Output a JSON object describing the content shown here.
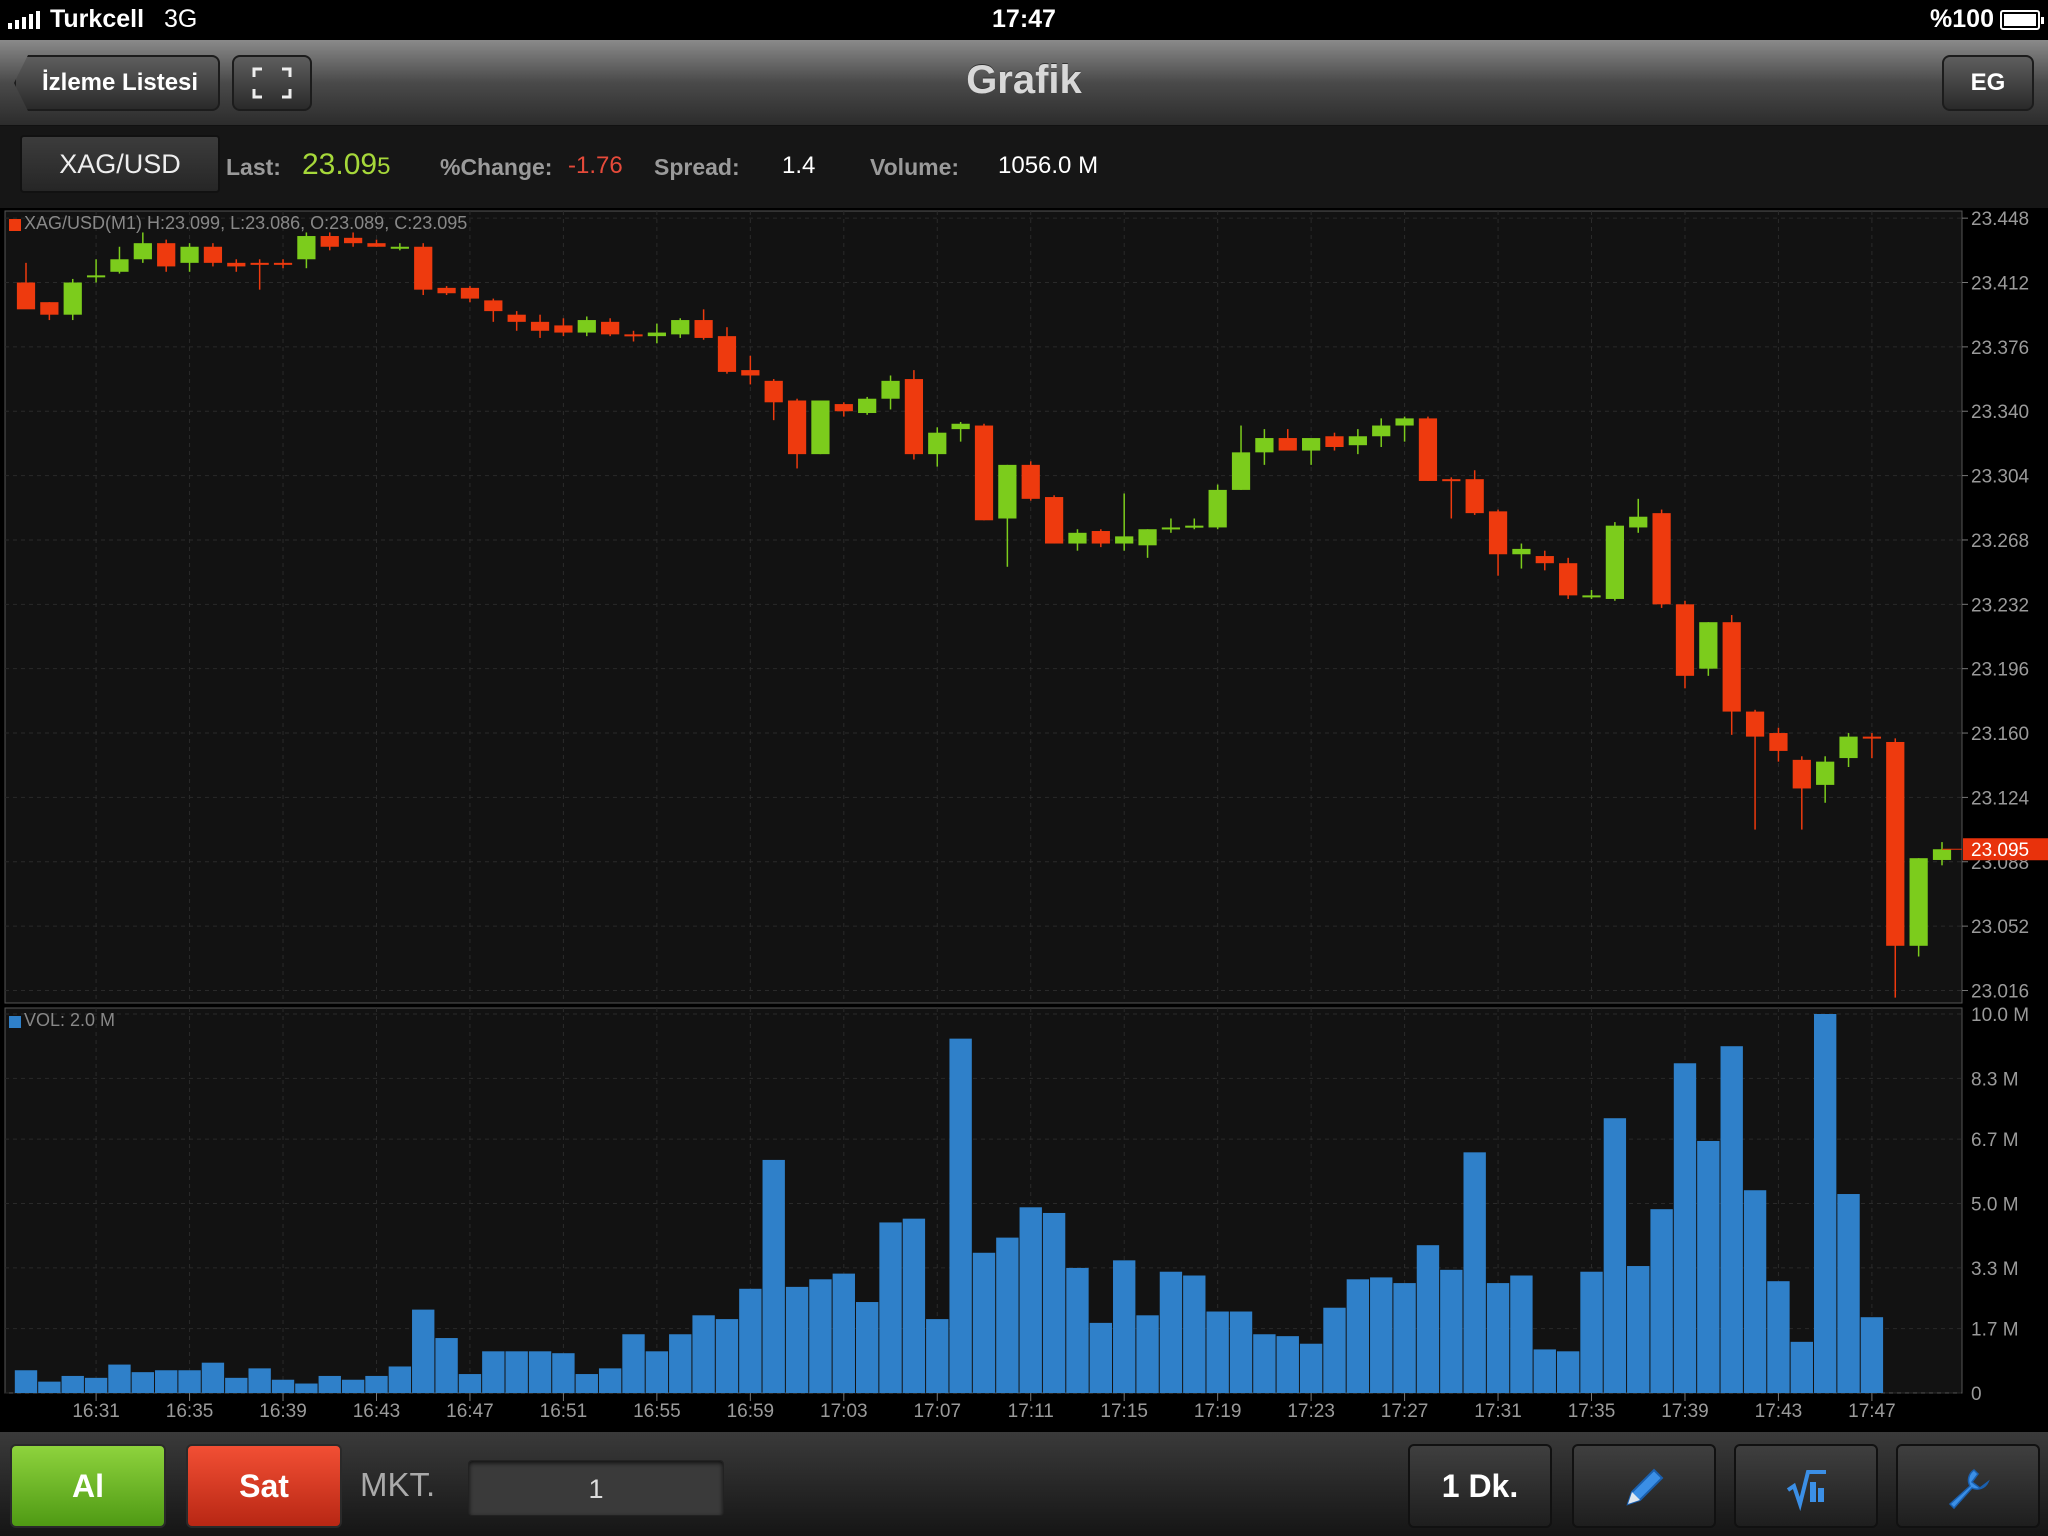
{
  "status_bar": {
    "carrier": "Turkcell",
    "network": "3G",
    "time": "17:47",
    "battery": "%100"
  },
  "nav": {
    "back_label": "İzleme Listesi",
    "title": "Grafik",
    "right_label": "EG"
  },
  "quote": {
    "symbol": "XAG/USD",
    "last_label": "Last:",
    "last_value": "23.09",
    "last_suffix": "5",
    "change_label": "%Change:",
    "change_value": "-1.76",
    "spread_label": "Spread:",
    "spread_value": "1.4",
    "volume_label": "Volume:",
    "volume_value": "1056.0 M"
  },
  "colors": {
    "up": "#7ccc1c",
    "down": "#ee3a0e",
    "volume": "#2f80c9",
    "last_marker": "#e8320c",
    "grid": "#2a2a2a",
    "axis_text": "#9a9a9a"
  },
  "toolbar": {
    "buy_label": "Al",
    "sell_label": "Sat",
    "order_type": "MKT.",
    "quantity": "1",
    "period_label": "1 Dk.",
    "draw_icon": "pencil-icon",
    "indicator_icon": "indicator-icon",
    "settings_icon": "wrench-icon"
  },
  "chart_data": {
    "type": "candlestick",
    "price_legend": "XAG/USD(M1) H:23.099, L:23.086, O:23.089, C:23.095",
    "volume_legend": "VOL: 2.0 M",
    "price_ylim": [
      23.009,
      23.452
    ],
    "price_ticks": [
      "23.448",
      "23.412",
      "23.376",
      "23.340",
      "23.304",
      "23.268",
      "23.232",
      "23.196",
      "23.160",
      "23.124",
      "23.088",
      "23.052",
      "23.016"
    ],
    "last_price": "23.095",
    "volume_ylim": [
      0,
      10.0
    ],
    "volume_ticks": [
      "10.0 M",
      "8.3 M",
      "6.7 M",
      "5.0 M",
      "3.3 M",
      "1.7 M",
      "0"
    ],
    "x_ticks": [
      "16:31",
      "16:35",
      "16:39",
      "16:43",
      "16:47",
      "16:51",
      "16:55",
      "16:59",
      "17:03",
      "17:07",
      "17:11",
      "17:15",
      "17:19",
      "17:23",
      "17:27",
      "17:31",
      "17:35",
      "17:39",
      "17:43",
      "17:47"
    ],
    "candles": [
      {
        "o": 23.412,
        "h": 23.423,
        "l": 23.404,
        "c": 23.397
      },
      {
        "o": 23.401,
        "h": 23.401,
        "l": 23.391,
        "c": 23.394
      },
      {
        "o": 23.394,
        "h": 23.414,
        "l": 23.391,
        "c": 23.412
      },
      {
        "o": 23.416,
        "h": 23.425,
        "l": 23.412,
        "c": 23.416
      },
      {
        "o": 23.418,
        "h": 23.432,
        "l": 23.417,
        "c": 23.425
      },
      {
        "o": 23.425,
        "h": 23.44,
        "l": 23.423,
        "c": 23.434
      },
      {
        "o": 23.434,
        "h": 23.436,
        "l": 23.418,
        "c": 23.421
      },
      {
        "o": 23.423,
        "h": 23.434,
        "l": 23.418,
        "c": 23.432
      },
      {
        "o": 23.432,
        "h": 23.434,
        "l": 23.421,
        "c": 23.423
      },
      {
        "o": 23.423,
        "h": 23.425,
        "l": 23.418,
        "c": 23.421
      },
      {
        "o": 23.423,
        "h": 23.425,
        "l": 23.408,
        "c": 23.422
      },
      {
        "o": 23.423,
        "h": 23.425,
        "l": 23.42,
        "c": 23.422
      },
      {
        "o": 23.425,
        "h": 23.44,
        "l": 23.42,
        "c": 23.438
      },
      {
        "o": 23.438,
        "h": 23.44,
        "l": 23.43,
        "c": 23.432
      },
      {
        "o": 23.437,
        "h": 23.44,
        "l": 23.432,
        "c": 23.434
      },
      {
        "o": 23.434,
        "h": 23.436,
        "l": 23.432,
        "c": 23.432
      },
      {
        "o": 23.432,
        "h": 23.434,
        "l": 23.43,
        "c": 23.432
      },
      {
        "o": 23.432,
        "h": 23.434,
        "l": 23.405,
        "c": 23.408
      },
      {
        "o": 23.409,
        "h": 23.41,
        "l": 23.405,
        "c": 23.406
      },
      {
        "o": 23.409,
        "h": 23.41,
        "l": 23.401,
        "c": 23.403
      },
      {
        "o": 23.402,
        "h": 23.403,
        "l": 23.39,
        "c": 23.396
      },
      {
        "o": 23.394,
        "h": 23.396,
        "l": 23.385,
        "c": 23.39
      },
      {
        "o": 23.39,
        "h": 23.394,
        "l": 23.381,
        "c": 23.385
      },
      {
        "o": 23.388,
        "h": 23.392,
        "l": 23.382,
        "c": 23.384
      },
      {
        "o": 23.384,
        "h": 23.393,
        "l": 23.382,
        "c": 23.391
      },
      {
        "o": 23.39,
        "h": 23.392,
        "l": 23.382,
        "c": 23.383
      },
      {
        "o": 23.383,
        "h": 23.385,
        "l": 23.379,
        "c": 23.382
      },
      {
        "o": 23.382,
        "h": 23.389,
        "l": 23.378,
        "c": 23.384
      },
      {
        "o": 23.383,
        "h": 23.392,
        "l": 23.381,
        "c": 23.391
      },
      {
        "o": 23.391,
        "h": 23.397,
        "l": 23.38,
        "c": 23.381
      },
      {
        "o": 23.382,
        "h": 23.387,
        "l": 23.361,
        "c": 23.362
      },
      {
        "o": 23.363,
        "h": 23.371,
        "l": 23.355,
        "c": 23.36
      },
      {
        "o": 23.357,
        "h": 23.358,
        "l": 23.335,
        "c": 23.345
      },
      {
        "o": 23.346,
        "h": 23.347,
        "l": 23.308,
        "c": 23.316
      },
      {
        "o": 23.316,
        "h": 23.346,
        "l": 23.316,
        "c": 23.346
      },
      {
        "o": 23.344,
        "h": 23.345,
        "l": 23.337,
        "c": 23.34
      },
      {
        "o": 23.339,
        "h": 23.348,
        "l": 23.338,
        "c": 23.347
      },
      {
        "o": 23.347,
        "h": 23.36,
        "l": 23.341,
        "c": 23.357
      },
      {
        "o": 23.358,
        "h": 23.363,
        "l": 23.313,
        "c": 23.316
      },
      {
        "o": 23.316,
        "h": 23.331,
        "l": 23.309,
        "c": 23.328
      },
      {
        "o": 23.33,
        "h": 23.334,
        "l": 23.323,
        "c": 23.333
      },
      {
        "o": 23.332,
        "h": 23.333,
        "l": 23.279,
        "c": 23.279
      },
      {
        "o": 23.28,
        "h": 23.31,
        "l": 23.253,
        "c": 23.31
      },
      {
        "o": 23.31,
        "h": 23.312,
        "l": 23.29,
        "c": 23.291
      },
      {
        "o": 23.292,
        "h": 23.293,
        "l": 23.266,
        "c": 23.266
      },
      {
        "o": 23.266,
        "h": 23.274,
        "l": 23.262,
        "c": 23.272
      },
      {
        "o": 23.273,
        "h": 23.274,
        "l": 23.264,
        "c": 23.266
      },
      {
        "o": 23.266,
        "h": 23.294,
        "l": 23.262,
        "c": 23.27
      },
      {
        "o": 23.265,
        "h": 23.274,
        "l": 23.258,
        "c": 23.274
      },
      {
        "o": 23.274,
        "h": 23.28,
        "l": 23.272,
        "c": 23.275
      },
      {
        "o": 23.276,
        "h": 23.28,
        "l": 23.274,
        "c": 23.276
      },
      {
        "o": 23.275,
        "h": 23.299,
        "l": 23.274,
        "c": 23.296
      },
      {
        "o": 23.296,
        "h": 23.332,
        "l": 23.296,
        "c": 23.317
      },
      {
        "o": 23.317,
        "h": 23.33,
        "l": 23.31,
        "c": 23.325
      },
      {
        "o": 23.325,
        "h": 23.33,
        "l": 23.32,
        "c": 23.318
      },
      {
        "o": 23.318,
        "h": 23.32,
        "l": 23.31,
        "c": 23.325
      },
      {
        "o": 23.326,
        "h": 23.328,
        "l": 23.318,
        "c": 23.32
      },
      {
        "o": 23.321,
        "h": 23.33,
        "l": 23.316,
        "c": 23.326
      },
      {
        "o": 23.326,
        "h": 23.336,
        "l": 23.32,
        "c": 23.332
      },
      {
        "o": 23.332,
        "h": 23.337,
        "l": 23.323,
        "c": 23.336
      },
      {
        "o": 23.336,
        "h": 23.337,
        "l": 23.301,
        "c": 23.301
      },
      {
        "o": 23.302,
        "h": 23.303,
        "l": 23.28,
        "c": 23.301
      },
      {
        "o": 23.302,
        "h": 23.307,
        "l": 23.282,
        "c": 23.283
      },
      {
        "o": 23.284,
        "h": 23.285,
        "l": 23.248,
        "c": 23.26
      },
      {
        "o": 23.26,
        "h": 23.266,
        "l": 23.252,
        "c": 23.263
      },
      {
        "o": 23.259,
        "h": 23.262,
        "l": 23.251,
        "c": 23.255
      },
      {
        "o": 23.255,
        "h": 23.258,
        "l": 23.235,
        "c": 23.237
      },
      {
        "o": 23.237,
        "h": 23.24,
        "l": 23.235,
        "c": 23.237
      },
      {
        "o": 23.235,
        "h": 23.278,
        "l": 23.234,
        "c": 23.276
      },
      {
        "o": 23.275,
        "h": 23.291,
        "l": 23.272,
        "c": 23.281
      },
      {
        "o": 23.283,
        "h": 23.285,
        "l": 23.23,
        "c": 23.232
      },
      {
        "o": 23.232,
        "h": 23.234,
        "l": 23.185,
        "c": 23.192
      },
      {
        "o": 23.196,
        "h": 23.222,
        "l": 23.192,
        "c": 23.222
      },
      {
        "o": 23.222,
        "h": 23.226,
        "l": 23.159,
        "c": 23.172
      },
      {
        "o": 23.172,
        "h": 23.173,
        "l": 23.106,
        "c": 23.158
      },
      {
        "o": 23.16,
        "h": 23.163,
        "l": 23.144,
        "c": 23.15
      },
      {
        "o": 23.145,
        "h": 23.147,
        "l": 23.106,
        "c": 23.129
      },
      {
        "o": 23.131,
        "h": 23.147,
        "l": 23.121,
        "c": 23.144
      },
      {
        "o": 23.146,
        "h": 23.16,
        "l": 23.141,
        "c": 23.158
      },
      {
        "o": 23.158,
        "h": 23.16,
        "l": 23.146,
        "c": 23.157
      },
      {
        "o": 23.155,
        "h": 23.157,
        "l": 23.012,
        "c": 23.041
      },
      {
        "o": 23.041,
        "h": 23.09,
        "l": 23.035,
        "c": 23.09
      },
      {
        "o": 23.089,
        "h": 23.099,
        "l": 23.086,
        "c": 23.095
      }
    ],
    "volume": [
      0.6,
      0.3,
      0.45,
      0.4,
      0.75,
      0.55,
      0.6,
      0.6,
      0.8,
      0.4,
      0.65,
      0.35,
      0.25,
      0.45,
      0.35,
      0.45,
      0.7,
      2.2,
      1.45,
      0.5,
      1.1,
      1.1,
      1.1,
      1.05,
      0.5,
      0.65,
      1.55,
      1.1,
      1.55,
      2.05,
      1.95,
      2.75,
      6.15,
      2.8,
      3.0,
      3.15,
      2.4,
      4.5,
      4.6,
      1.95,
      9.35,
      3.7,
      4.1,
      4.9,
      4.75,
      3.3,
      1.85,
      3.5,
      2.05,
      3.2,
      3.1,
      2.15,
      2.15,
      1.55,
      1.5,
      1.3,
      2.25,
      3.0,
      3.05,
      2.9,
      3.9,
      3.25,
      6.35,
      2.9,
      3.1,
      1.15,
      1.1,
      3.2,
      7.25,
      3.35,
      4.85,
      8.7,
      6.65,
      9.15,
      5.35,
      2.95,
      1.35,
      10.0,
      5.25,
      2.0
    ]
  }
}
